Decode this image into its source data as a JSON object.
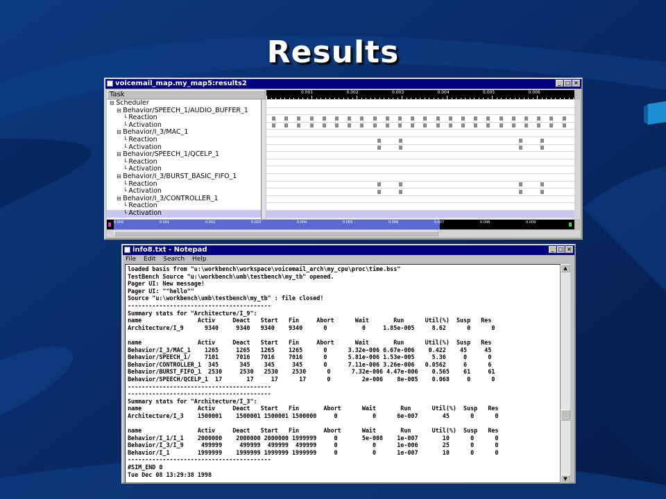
{
  "slide": {
    "title": "Results"
  },
  "colors": {
    "background": "#0a2a66",
    "titlebar": "#000080",
    "selection_band": "#c8c8f0",
    "event_mark": "#8a8a8a"
  },
  "results_window": {
    "title": "voicemail_map.my_map5:results2",
    "column_header": "Task",
    "ruler_ticks": [
      "0.001",
      "0.002",
      "0.003",
      "0.004",
      "0.005",
      "0.006"
    ],
    "overview_ticks": [
      "0.000",
      "0.001",
      "0.002",
      "0.003",
      "0.004",
      "0.005",
      "0.006",
      "0.007",
      "0.008",
      "0.009"
    ],
    "tree": [
      {
        "label": "Scheduler",
        "level": 0
      },
      {
        "label": "Behavior/SPEECH_1/AUDIO_BUFFER_1",
        "level": 1
      },
      {
        "label": "Reaction",
        "level": 2
      },
      {
        "label": "Activation",
        "level": 2
      },
      {
        "label": "Behavior/I_3/MAC_1",
        "level": 1
      },
      {
        "label": "Reaction",
        "level": 2
      },
      {
        "label": "Activation",
        "level": 2
      },
      {
        "label": "Behavior/SPEECH_1/QCELP_1",
        "level": 1
      },
      {
        "label": "Reaction",
        "level": 2
      },
      {
        "label": "Activation",
        "level": 2
      },
      {
        "label": "Behavior/I_3/BURST_BASIC_FIFO_1",
        "level": 1
      },
      {
        "label": "Reaction",
        "level": 2
      },
      {
        "label": "Activation",
        "level": 2
      },
      {
        "label": "Behavior/I_3/CONTROLLER_1",
        "level": 1
      },
      {
        "label": "Reaction",
        "level": 2
      },
      {
        "label": "Activation",
        "level": 2,
        "selected": true
      }
    ]
  },
  "notepad_window": {
    "title": "info8.txt - Notepad",
    "menu": [
      "File",
      "Edit",
      "Search",
      "Help"
    ],
    "lines": [
      "loaded basis from \"u:\\workbench\\workspace\\voicemail_arch\\my_cpu\\proc\\time.bss\"",
      "TestBench Source \"u:\\workbench\\umb\\testbench\\my_tb\" opened.",
      "Pager UI: New message!",
      "Pager UI: \"\"hello\"\"",
      "Source \"u:\\workbench\\umb\\testbench\\my_tb\" : file closed!",
      "-----------------------------------------",
      "Summary stats for \"Architecture/I_9\":",
      "name                Activ     Deact   Start   Fin     Abort      Wait       Run      Util(%)  Susp   Res",
      "Architecture/I_9      9340     9340   9340    9340      0          0     1.85e-005     8.62      0      0",
      "",
      "name                Activ     Deact   Start   Fin     Abort      Wait       Run      Util(%)  Susp   Res",
      "Behavior/I_3/MAC_1    1265     1265   1265    1265      0      3.32e-006 6.67e-006    0.422    45     45",
      "Behavior/SPEECH_1/    7101     7016   7016    7016      0      5.81e-006 1.53e-005     5.36     0      0",
      "Behavior/CONTROLLER_1  345      345    345     345      0      7.11e-006 3.26e-006   0.0562     6      6",
      "Behavior/BURST_FIFO_1  2530     2530   2530    2530      0      7.32e-006 4.47e-006    0.565    61     61",
      "Behavior/SPEECH/QCELP_1  17       17     17      17      0         2e-006    8e-005    0.068     0      0",
      "-----------------------------------------",
      "-----------------------------------------",
      "Summary stats for \"Architecture/I_3\":",
      "name                Activ     Deact   Start   Fin       Abort      Wait       Run      Util(%)  Susp   Res",
      "Architecture/I_3    1500001    1500001 1500001 1500000     0          0      6e-007       45      0      0",
      "",
      "name                Activ     Deact   Start   Fin       Abort      Wait       Run      Util(%)  Susp   Res",
      "Behavior/I_1/I_1    2000000    2000000 2000000 1999999     0       5e-008    1e-007       10      0      0",
      "Behavior/I_3/I_9     499999     499999  499999  499999     0          0      1e-006       25      0      0",
      "Behavior/I_1        1999999    1999999 1999999 1999999     0          0      1e-007       10      0      0",
      "-----------------------------------------",
      "#SIM_END 0",
      "Tue Dec 08 13:29:38 1998"
    ]
  }
}
